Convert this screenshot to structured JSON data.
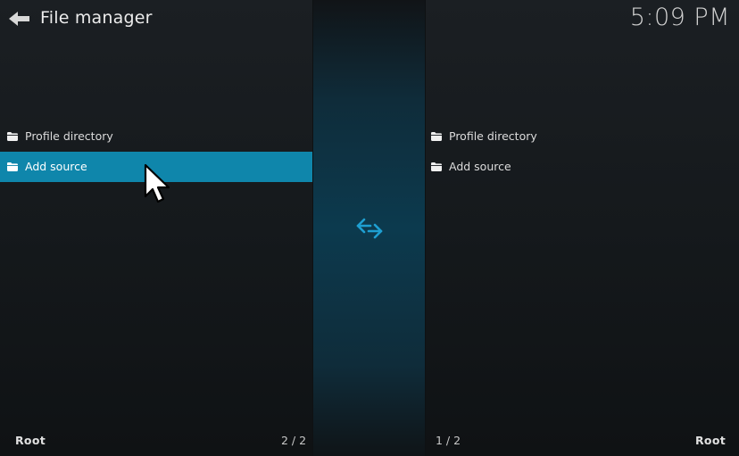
{
  "header": {
    "title": "File manager",
    "clock": "5:09 PM",
    "back_icon": "back-arrow-icon"
  },
  "left_pane": {
    "items": [
      {
        "label": "Profile directory",
        "icon": "folder-icon",
        "selected": false
      },
      {
        "label": "Add source",
        "icon": "folder-icon",
        "selected": true
      }
    ],
    "footer_label": "Root",
    "footer_count": "2 / 2"
  },
  "right_pane": {
    "items": [
      {
        "label": "Profile directory",
        "icon": "folder-icon",
        "selected": false
      },
      {
        "label": "Add source",
        "icon": "folder-icon",
        "selected": false
      }
    ],
    "footer_label": "Root",
    "footer_count": "1 / 2"
  },
  "center": {
    "icon": "swap-arrows-icon"
  },
  "colors": {
    "accent": "#0f86ab",
    "swap_icon": "#1e9fd1",
    "background": "#15191d"
  }
}
